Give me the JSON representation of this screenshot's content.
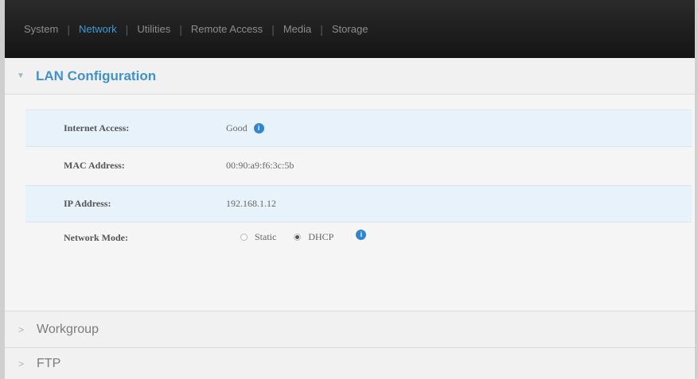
{
  "nav": {
    "items": [
      {
        "label": "System",
        "active": false
      },
      {
        "label": "Network",
        "active": true
      },
      {
        "label": "Utilities",
        "active": false
      },
      {
        "label": "Remote Access",
        "active": false
      },
      {
        "label": "Media",
        "active": false
      },
      {
        "label": "Storage",
        "active": false
      }
    ],
    "separator": "|"
  },
  "lan": {
    "title": "LAN Configuration",
    "rows": {
      "internet_access": {
        "label": "Internet Access:",
        "value": "Good"
      },
      "mac_address": {
        "label": "MAC Address:",
        "value": "00:90:a9:f6:3c:5b"
      },
      "ip_address": {
        "label": "IP Address:",
        "value": "192.168.1.12"
      },
      "network_mode": {
        "label": "Network Mode:",
        "options": [
          {
            "label": "Static",
            "selected": false
          },
          {
            "label": "DHCP",
            "selected": true
          }
        ]
      }
    }
  },
  "sections": {
    "workgroup": "Workgroup",
    "ftp": "FTP"
  },
  "icons": {
    "info": "i",
    "expanded": "▼",
    "collapsed": ">"
  },
  "colors": {
    "accent": "#3d93d2",
    "nav_bg": "#1c1c1c",
    "row_highlight": "#e7f2fa"
  }
}
